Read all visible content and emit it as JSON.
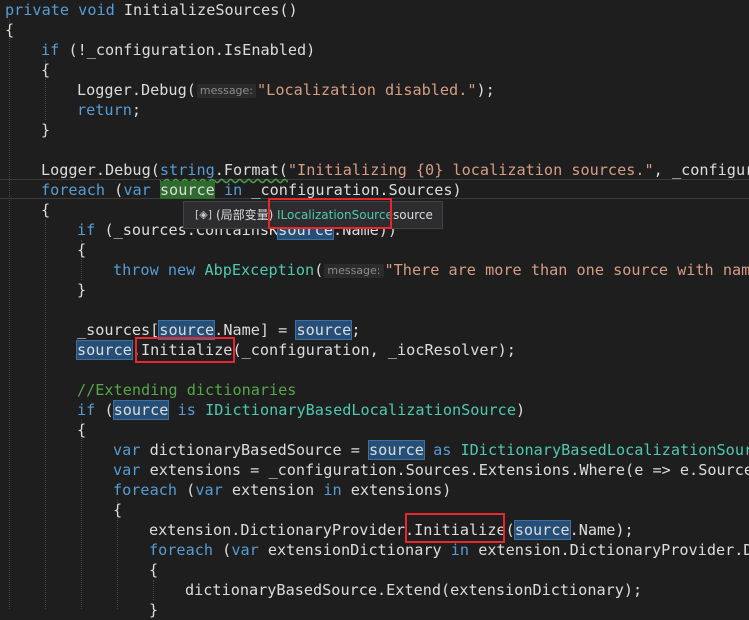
{
  "editor": {
    "lines": {
      "l0": {
        "kw1": "private",
        "kw2": "void",
        "name": "InitializeSources()"
      },
      "l1": {
        "text": "{"
      },
      "l2": {
        "kw": "if",
        "text": " (!_configuration.IsEnabled)"
      },
      "l3": {
        "text": "{"
      },
      "l4": {
        "pre": "Logger.Debug(",
        "hint": "message:",
        "str": "\"Localization disabled.\"",
        "post": ");"
      },
      "l5": {
        "kw": "return",
        "post": ";"
      },
      "l6": {
        "text": "}"
      },
      "l8": {
        "pre": "Logger.Debug(",
        "kw": "string",
        "mid": ".Format(",
        "str": "\"Initializing {0} localization sources.\"",
        "post": ", _configura"
      },
      "l9": {
        "kw1": "foreach",
        "p1": " (",
        "kw2": "var",
        "var": "source",
        "kw3": "in",
        "post": " _configuration.Sources)"
      },
      "l10": {
        "text": "{"
      },
      "l11": {
        "kw": "if",
        "pre": " (_sources.ContainsK",
        "var": "source",
        "post": ".Name))"
      },
      "l12": {
        "text": "{"
      },
      "l13": {
        "kw1": "throw",
        "kw2": "new",
        "type": "AbpException",
        "p": "(",
        "hint": "message:",
        "str": "\"There are more than one source with name"
      },
      "l14": {
        "text": "}"
      },
      "l16": {
        "pre": "_sources[",
        "var": "source",
        "mid": ".Name] = ",
        "var2": "source",
        "post": ";"
      },
      "l17": {
        "var": "source",
        "post": ".Initialize(_configuration, _iocResolver);"
      },
      "l19": {
        "comment": "//Extending dictionaries"
      },
      "l20": {
        "kw1": "if",
        "p1": " (",
        "var": "source",
        "kw2": "is",
        "type": "IDictionaryBasedLocalizationSource",
        "post": ")"
      },
      "l21": {
        "text": "{"
      },
      "l22": {
        "kw1": "var",
        "mid": " dictionaryBasedSource = ",
        "var": "source",
        "kw2": "as",
        "type": "IDictionaryBasedLocalizationSourc"
      },
      "l23": {
        "kw": "var",
        "post": " extensions = _configuration.Sources.Extensions.Where(e => e.SourceN"
      },
      "l24": {
        "kw1": "foreach",
        "p1": " (",
        "kw2": "var",
        "mid": " extension ",
        "kw3": "in",
        "post": " extensions)"
      },
      "l25": {
        "text": "{"
      },
      "l26": {
        "pre": "extension.DictionaryProvider.Initialize(",
        "var": "source",
        "post": ".Name);"
      },
      "l27": {
        "kw1": "foreach",
        "p1": " (",
        "kw2": "var",
        "mid": " extensionDictionary ",
        "kw3": "in",
        "post": " extension.DictionaryProvider.Di"
      },
      "l28": {
        "text": "{"
      },
      "l29": {
        "text": "dictionaryBasedSource.Extend(extensionDictionary);"
      },
      "l30": {
        "text": "}"
      }
    }
  },
  "tooltip": {
    "icon": "[◈]",
    "label": "(局部变量)",
    "type": "ILocalizationSource",
    "name": "source"
  },
  "colors": {
    "background": "#1e1e1e",
    "keyword": "#569cd6",
    "string": "#d69d85",
    "comment": "#57a64a",
    "type": "#4ec9b0",
    "highlight": "#264f78",
    "annotation_box": "#e8262d"
  }
}
